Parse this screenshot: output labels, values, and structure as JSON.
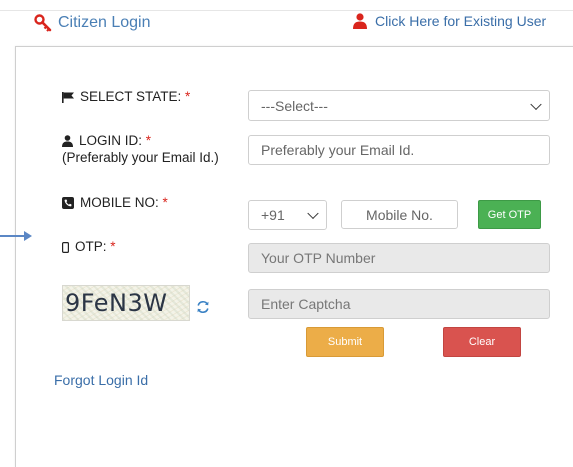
{
  "header": {
    "title": "Citizen Login",
    "existing_user_link": "Click Here for Existing User"
  },
  "form": {
    "state": {
      "label": "SELECT STATE:",
      "required": "*",
      "selected": "---Select---"
    },
    "login": {
      "label": "LOGIN ID:",
      "required": "*",
      "hint": "(Preferably your Email Id.)",
      "placeholder": "Preferably your Email Id."
    },
    "mobile": {
      "label": "MOBILE NO:",
      "required": "*",
      "country_code": "+91",
      "placeholder": "Mobile No.",
      "otp_button": "Get OTP"
    },
    "otp": {
      "label": "OTP:",
      "required": "*",
      "placeholder": "Your OTP Number"
    },
    "captcha": {
      "text": "9FeN3W",
      "placeholder": "Enter Captcha"
    },
    "submit_label": "Submit",
    "clear_label": "Clear",
    "forgot_link": "Forgot Login Id"
  },
  "colors": {
    "accent_red": "#d9251d",
    "link_blue": "#3a6ea8",
    "otp_green": "#4bb154",
    "submit_orange": "#ecad48",
    "clear_red": "#d9534f"
  },
  "icons": [
    "key-icon",
    "user-icon",
    "flag-icon",
    "user-small-icon",
    "phone-icon",
    "mobile-device-icon",
    "refresh-icon",
    "arrow-icon"
  ]
}
